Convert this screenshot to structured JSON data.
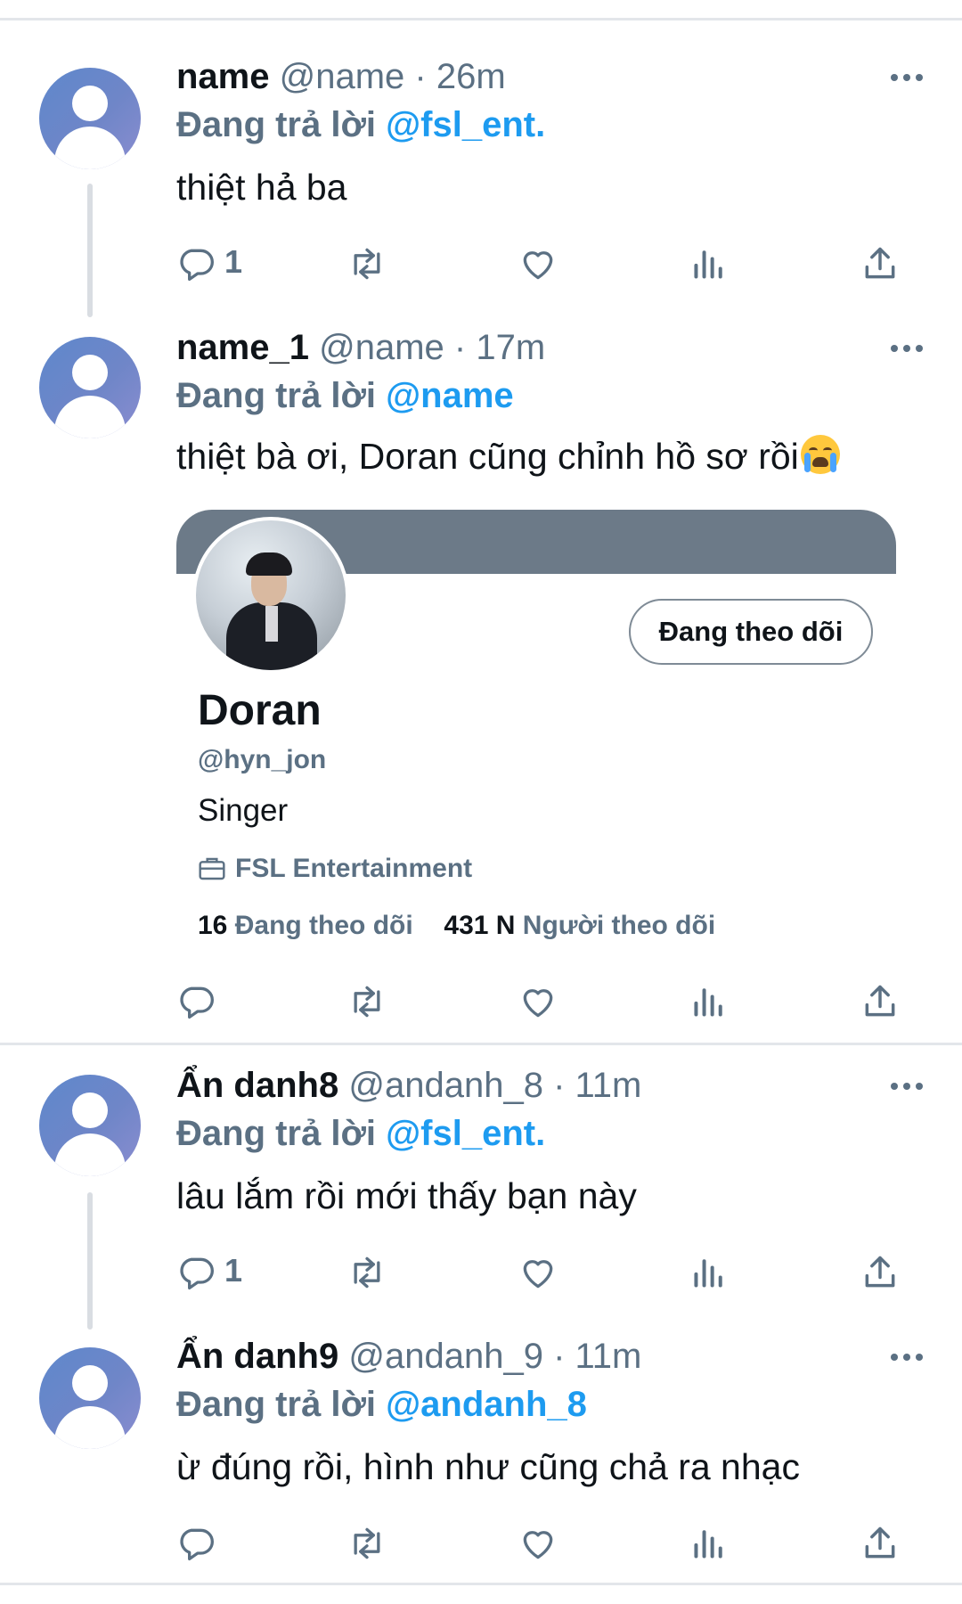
{
  "tweets": [
    {
      "name": "name",
      "handle": "@name",
      "time": "26m",
      "reply_prefix": "Đang trả lời",
      "reply_to": "@fsl_ent.",
      "text": "thiệt hả ba",
      "reply_count": "1"
    },
    {
      "name": "name_1",
      "handle": "@name",
      "time": "17m",
      "reply_prefix": "Đang trả lời",
      "reply_to": "@name",
      "text": "thiệt bà ơi, Doran cũng chỉnh hồ sơ rồi",
      "reply_count": ""
    },
    {
      "name": "Ẩn danh8",
      "handle": "@andanh_8",
      "time": "11m",
      "reply_prefix": "Đang trả lời",
      "reply_to": "@fsl_ent.",
      "text": "lâu lắm rồi mới thấy bạn này",
      "reply_count": "1"
    },
    {
      "name": "Ẩn danh9",
      "handle": "@andanh_9",
      "time": "11m",
      "reply_prefix": "Đang trả lời",
      "reply_to": "@andanh_8",
      "text": "ừ đúng rồi, hình như cũng chả ra nhạc",
      "reply_count": ""
    }
  ],
  "profile_card": {
    "follow_button": "Đang theo dõi",
    "name": "Doran",
    "handle": "@hyn_jon",
    "bio": "Singer",
    "work": "FSL Entertainment",
    "following_count": "16",
    "following_label": "Đang theo dõi",
    "followers_count": "431 N",
    "followers_label": "Người theo dõi"
  },
  "meta_separator": "·",
  "colors": {
    "link": "#1d9bf0",
    "secondary_text": "#5b7083",
    "primary_text": "#0f1419",
    "banner": "#6c7a88",
    "avatar": "#6f86c8",
    "divider": "#e3e6ea"
  },
  "icons": [
    "more-icon",
    "reply-icon",
    "retweet-icon",
    "like-icon",
    "views-icon",
    "share-icon",
    "crying-face-emoji",
    "briefcase-icon"
  ]
}
